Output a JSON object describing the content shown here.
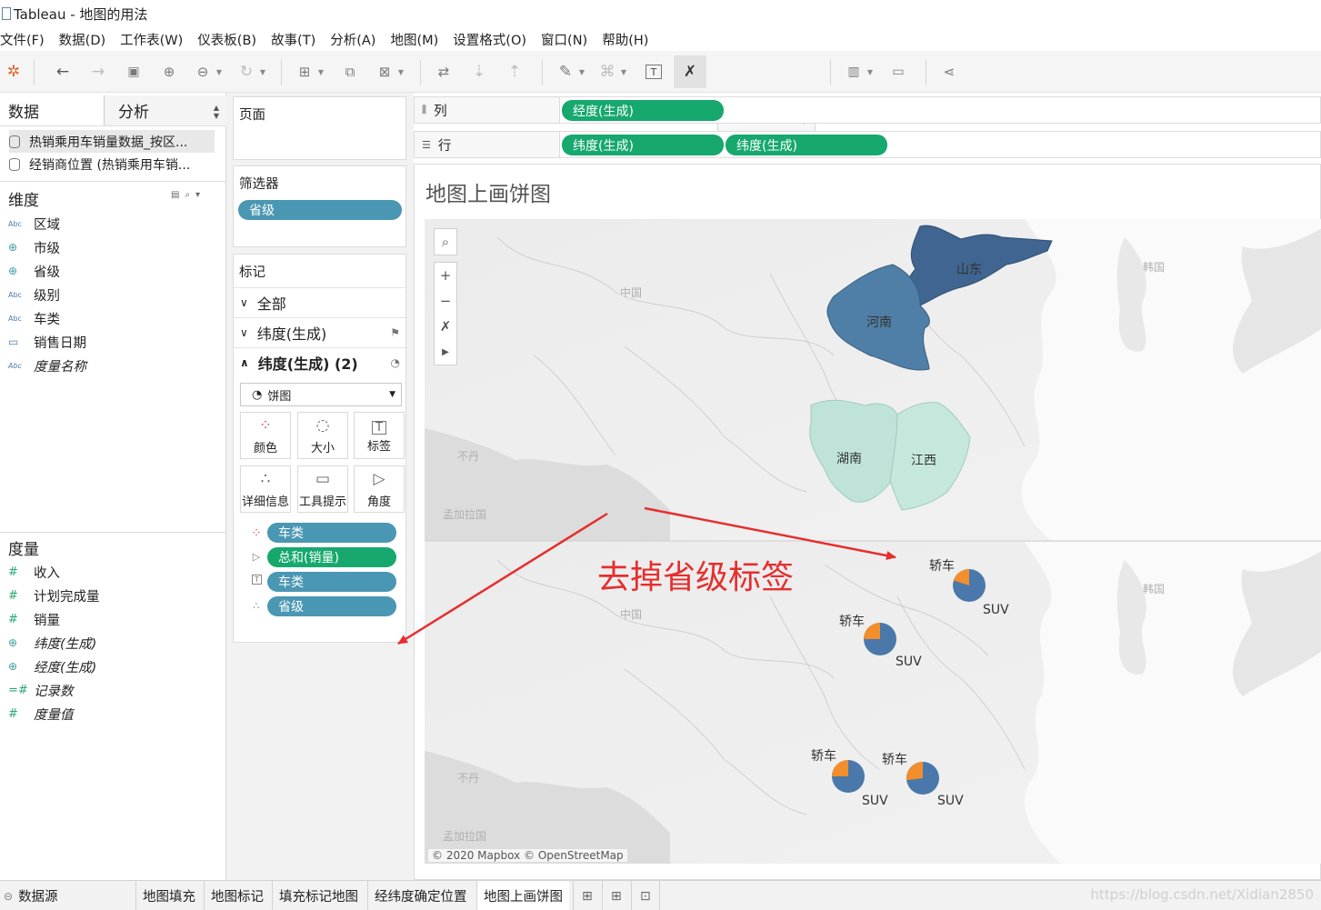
{
  "window": {
    "title": "Tableau - 地图的用法"
  },
  "menu": [
    "文件(F)",
    "数据(D)",
    "工作表(W)",
    "仪表板(B)",
    "故事(T)",
    "分析(A)",
    "地图(M)",
    "设置格式(O)",
    "窗口(N)",
    "帮助(H)"
  ],
  "toolbar": {
    "icons": [
      "tableau-logo-icon",
      "undo-icon",
      "redo-icon",
      "save-icon",
      "new-datasource-icon",
      "datasource-icon",
      "refresh-icon",
      "new-sheet-icon",
      "duplicate-sheet-icon",
      "clear-sheet-icon",
      "swap-icon",
      "sort-asc-icon",
      "sort-desc-icon",
      "highlight-icon",
      "paperclip-icon",
      "show-labels-icon",
      "fix-axes-icon",
      "show-me-icon",
      "presentation-icon",
      "share-icon"
    ],
    "fit_value": ""
  },
  "left_pane": {
    "tabs": {
      "data": "数据",
      "analysis": "分析"
    },
    "datasources": [
      "热销乘用车销量数据_按区...",
      "经销商位置 (热销乘用车销..."
    ],
    "dimensions_title": "维度",
    "dimensions": [
      {
        "type": "Abc",
        "name": "区域"
      },
      {
        "type": "⊕",
        "name": "市级"
      },
      {
        "type": "⊕",
        "name": "省级"
      },
      {
        "type": "Abc",
        "name": "级别"
      },
      {
        "type": "Abc",
        "name": "车类"
      },
      {
        "type": "▭",
        "name": "销售日期"
      },
      {
        "type": "Abc",
        "name": "度量名称"
      }
    ],
    "measures_title": "度量",
    "measures": [
      {
        "type": "#",
        "name": "收入"
      },
      {
        "type": "#",
        "name": "计划完成量"
      },
      {
        "type": "#",
        "name": "销量"
      },
      {
        "type": "⊕",
        "name": "纬度(生成)"
      },
      {
        "type": "⊕",
        "name": "经度(生成)"
      },
      {
        "type": "=#",
        "name": "记录数"
      },
      {
        "type": "#",
        "name": "度量值"
      }
    ]
  },
  "cards": {
    "pages_title": "页面",
    "filters_title": "筛选器",
    "filter_pill": "省级",
    "marks_title": "标记",
    "layers": [
      "全部",
      "纬度(生成)",
      "纬度(生成) (2)"
    ],
    "mark_type": "饼图",
    "mark_buttons": [
      "颜色",
      "大小",
      "标签",
      "详细信息",
      "工具提示",
      "角度"
    ],
    "mark_fields": [
      {
        "icon": "color-dots-icon",
        "label": "车类",
        "kind": "dimension"
      },
      {
        "icon": "angle-icon",
        "label": "总和(销量)",
        "kind": "measure"
      },
      {
        "icon": "label-icon",
        "label": "车类",
        "kind": "dimension"
      },
      {
        "icon": "detail-icon",
        "label": "省级",
        "kind": "dimension"
      }
    ]
  },
  "shelves": {
    "columns_label": "列",
    "rows_label": "行",
    "columns": [
      "经度(生成)"
    ],
    "rows": [
      "纬度(生成)",
      "纬度(生成)"
    ]
  },
  "sheet": {
    "title": "地图上画饼图",
    "map_controls": [
      "search-icon",
      "zoom-in-icon",
      "zoom-out-icon",
      "pin-icon",
      "expand-icon"
    ],
    "region_labels": [
      "中国",
      "韩国",
      "不丹",
      "孟加拉国",
      "中国",
      "韩国",
      "不丹",
      "孟加拉国"
    ],
    "provinces_top": [
      "山东",
      "河南",
      "湖南",
      "江西"
    ],
    "pies": [
      {
        "province": "山东",
        "label_top": "轿车",
        "label_bottom": "SUV",
        "orange_share": 0.2
      },
      {
        "province": "河南",
        "label_top": "轿车",
        "label_bottom": "SUV",
        "orange_share": 0.25
      },
      {
        "province": "湖南",
        "label_top": "轿车",
        "label_bottom": "SUV",
        "orange_share": 0.25
      },
      {
        "province": "江西",
        "label_top": "轿车",
        "label_bottom": "SUV",
        "orange_share": 0.27
      }
    ],
    "credit": "© 2020 Mapbox © OpenStreetMap"
  },
  "annotation": {
    "text": "去掉省级标签",
    "color": "#e62e2e"
  },
  "colors": {
    "dimension_pill": "#4a97b3",
    "measure_pill": "#17a86e",
    "shandong": "#3f6590",
    "henan": "#4f7fa6",
    "hunan": "#bfe3d8",
    "jiangxi": "#c6e8dc",
    "pie_blue": "#4a78ab",
    "pie_orange": "#f28e2b"
  },
  "bottom_tabs": {
    "datasource": "数据源",
    "sheets": [
      "地图填充",
      "地图标记",
      "填充标记地图",
      "经纬度确定位置",
      "地图上画饼图"
    ],
    "active": "地图上画饼图",
    "watermark": "https://blog.csdn.net/Xidian2850"
  }
}
